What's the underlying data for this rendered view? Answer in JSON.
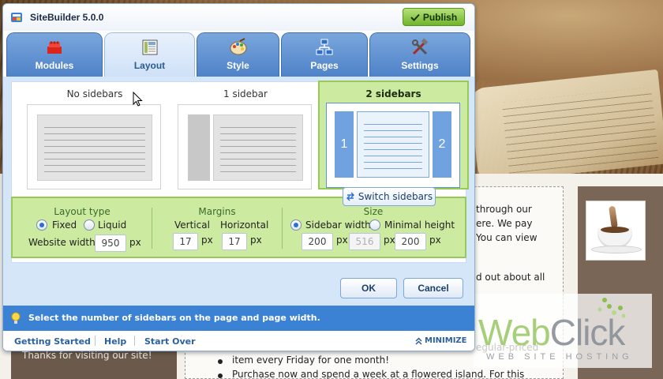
{
  "app": {
    "title": "SiteBuilder 5.0.0",
    "publish_label": "Publish"
  },
  "tabs": [
    {
      "label": "Modules",
      "icon": "bricks-icon"
    },
    {
      "label": "Layout",
      "icon": "layout-grid-icon",
      "active": true
    },
    {
      "label": "Style",
      "icon": "palette-icon"
    },
    {
      "label": "Pages",
      "icon": "sitemap-icon"
    },
    {
      "label": "Settings",
      "icon": "tools-icon"
    }
  ],
  "layout_options": [
    {
      "label": "No sidebars",
      "selected": false
    },
    {
      "label": "1 sidebar",
      "selected": false
    },
    {
      "label": "2 sidebars",
      "selected": true,
      "left_marker": "1",
      "right_marker": "2"
    }
  ],
  "switch_sidebars_label": "Switch sidebars",
  "layout_type": {
    "title": "Layout type",
    "fixed_label": "Fixed",
    "liquid_label": "Liquid",
    "selected": "Fixed",
    "website_width_label": "Website width",
    "website_width_value": "950",
    "unit": "px"
  },
  "margins": {
    "title": "Margins",
    "vertical_label": "Vertical",
    "horizontal_label": "Horizontal",
    "vertical_value": "17",
    "horizontal_value": "17",
    "unit": "px"
  },
  "size": {
    "title": "Size",
    "sidebar_width_label": "Sidebar width",
    "minimal_height_label": "Minimal height",
    "selected": "Sidebar width",
    "value1": "200",
    "value2": "516",
    "value3": "200",
    "unit": "px"
  },
  "buttons": {
    "ok": "OK",
    "cancel": "Cancel"
  },
  "hint": "Select the number of sidebars on the page and page width.",
  "footer": {
    "getting_started": "Getting Started",
    "help": "Help",
    "start_over": "Start Over",
    "minimize": "MINIMIZE"
  },
  "background_site": {
    "line1": "through our",
    "line2": "ere. We pay",
    "line3": "You can view",
    "line4": "d out about all",
    "line5": "egular-priced",
    "line6": "item every Friday for one month!",
    "line7": "Purchase now and spend a week at a flowered island. For this",
    "thanks": "Thanks for visiting our site!",
    "logo_web": "Web",
    "logo_click": "Click",
    "logo_sub": "WEB SITE HOSTING"
  },
  "colors": {
    "accent_blue": "#3b82d4",
    "selection_green": "#cdeaa1",
    "publish_green": "#6fb42a"
  }
}
